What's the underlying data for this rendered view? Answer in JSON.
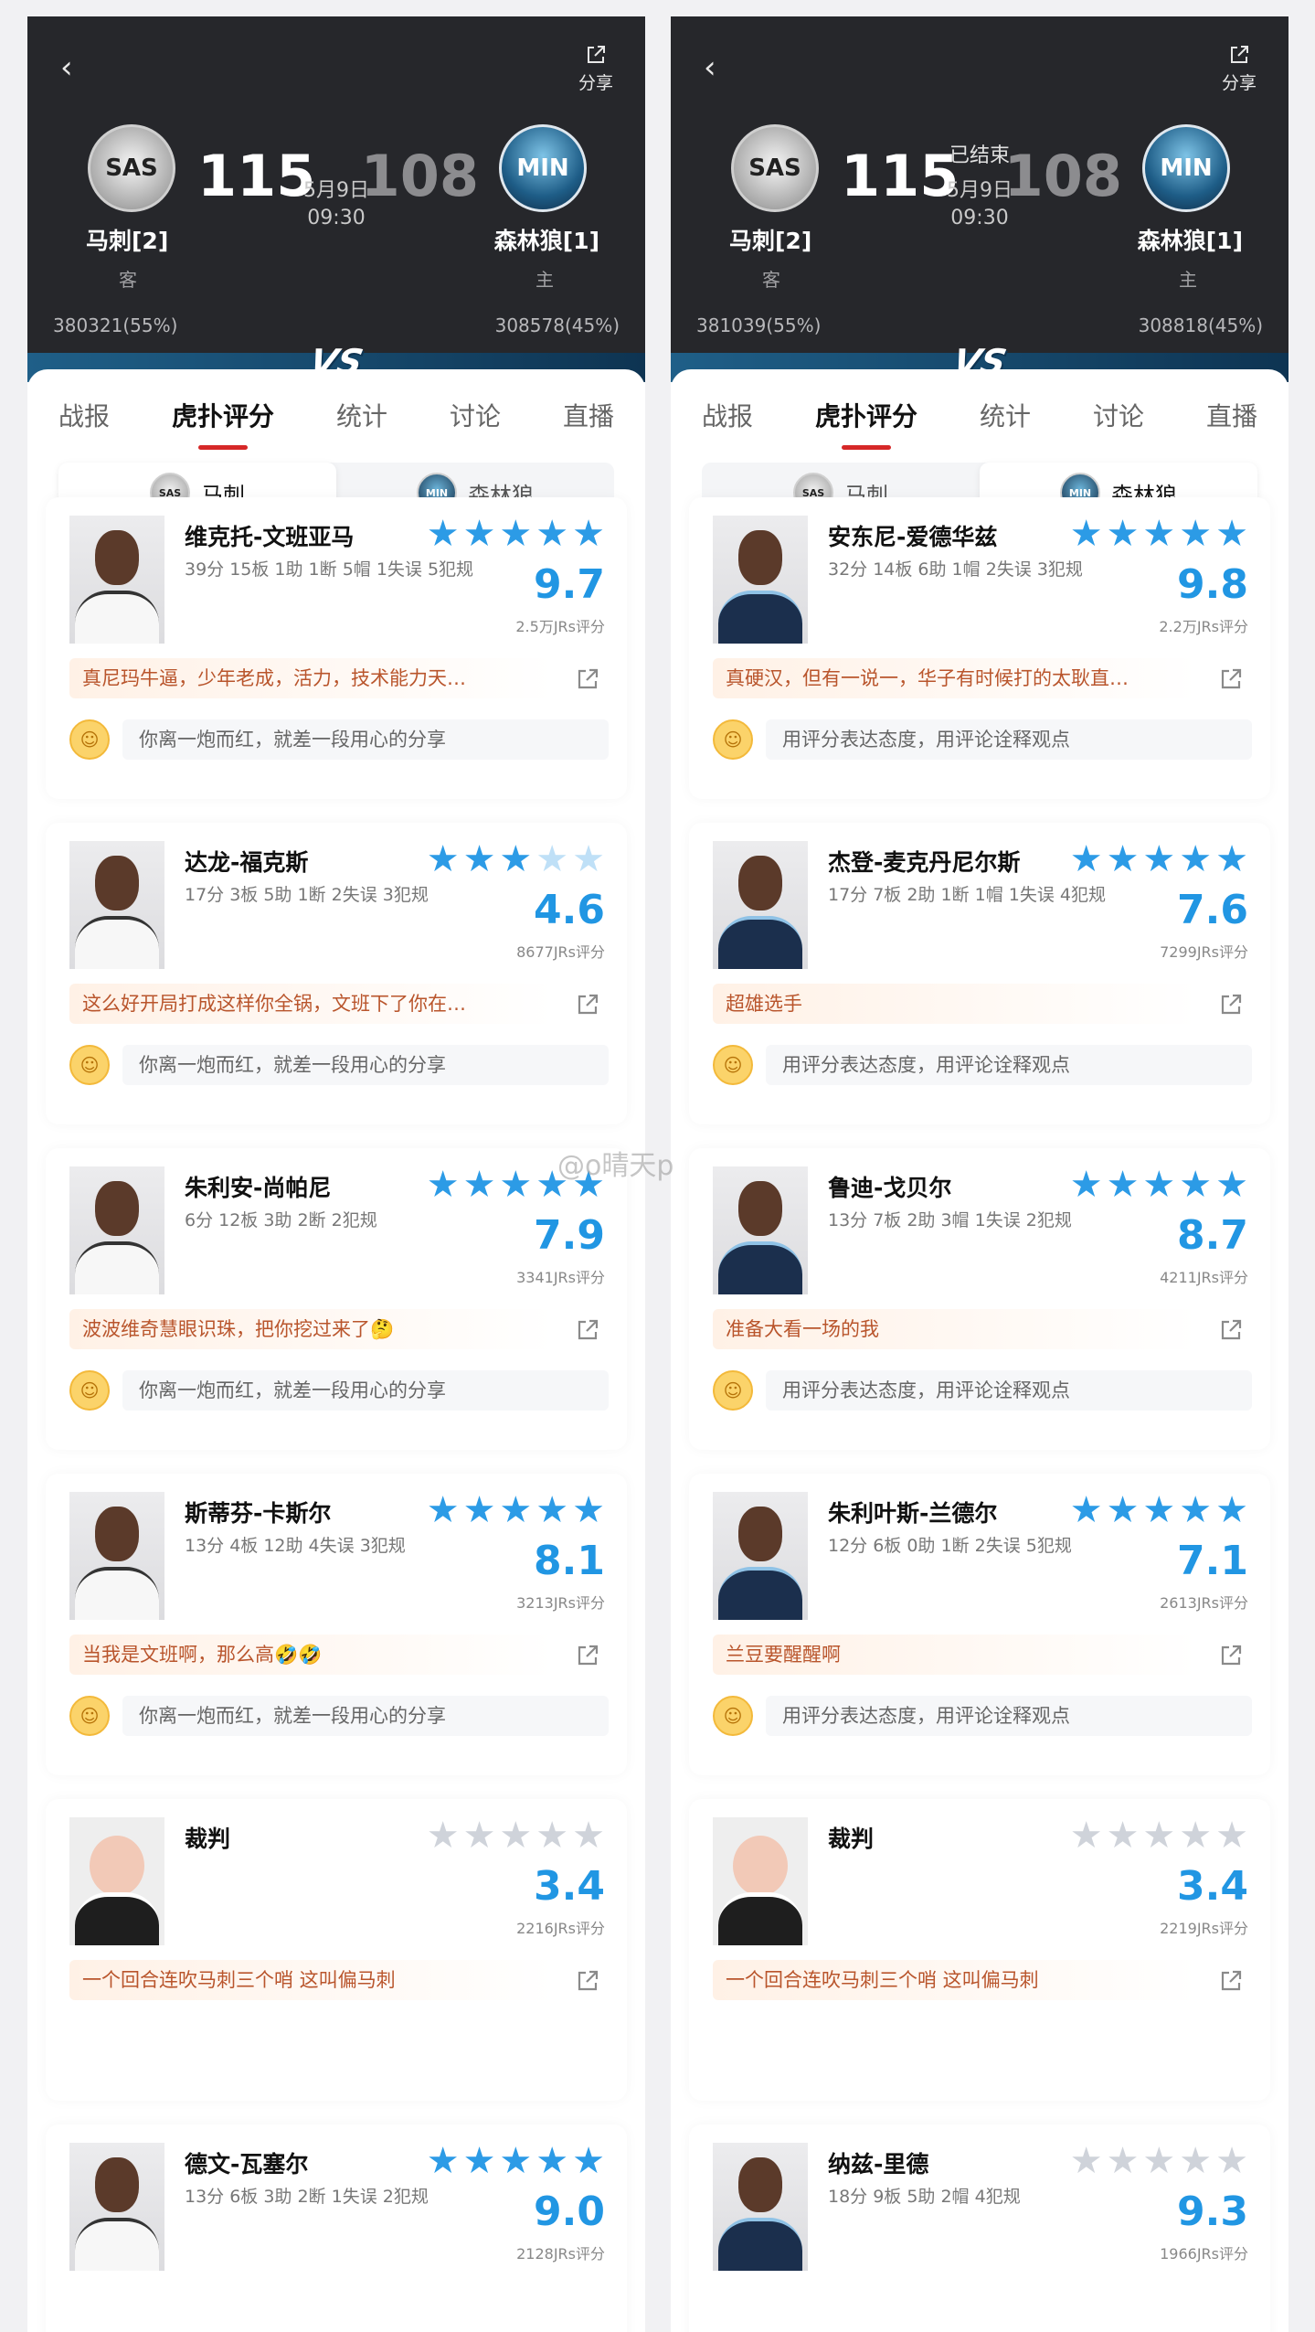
{
  "panels": [
    {
      "header": {
        "back_glyph": "‹",
        "share_label": "分享",
        "away": {
          "abbr": "SAS",
          "name": "马刺[2]",
          "role": "客",
          "score": "115",
          "votes": "380321(55%)"
        },
        "home": {
          "abbr": "MIN",
          "name": "森林狼[1]",
          "role": "主",
          "score": "108",
          "votes": "308578(45%)"
        },
        "status": "",
        "date": "5月9日",
        "time": "09:30",
        "vs": "VS"
      },
      "tabs": [
        "战报",
        "虎扑评分",
        "统计",
        "讨论",
        "直播"
      ],
      "active_tab": 1,
      "team_toggle": [
        {
          "abbr": "SAS",
          "label": "马刺",
          "selected": true
        },
        {
          "abbr": "MIN",
          "label": "森林狼",
          "selected": false
        }
      ],
      "cards": [
        {
          "name": "维克托-文班亚马",
          "stats": "39分 15板 1助 1断 5帽 1失误 5犯规",
          "rating": "9.7",
          "raters": "2.5万JRs评分",
          "stars": [
            1,
            1,
            1,
            1,
            1
          ],
          "comment": "真尼玛牛逼，少年老成，活力，技术能力天…",
          "prompt": "你离一炮而红，就差一段用心的分享",
          "kind": "spurs"
        },
        {
          "name": "达龙-福克斯",
          "stats": "17分 3板 5助 1断 2失误 3犯规",
          "rating": "4.6",
          "raters": "8677JRs评分",
          "stars": [
            1,
            1,
            1,
            0.5,
            0.5
          ],
          "comment": "这么好开局打成这样你全锅，文班下了你在…",
          "prompt": "你离一炮而红，就差一段用心的分享",
          "kind": "spurs"
        },
        {
          "name": "朱利安-尚帕尼",
          "stats": "6分 12板 3助 2断 2犯规",
          "rating": "7.9",
          "raters": "3341JRs评分",
          "stars": [
            1,
            1,
            1,
            1,
            1
          ],
          "comment": "波波维奇慧眼识珠，把你挖过来了🤔",
          "prompt": "你离一炮而红，就差一段用心的分享",
          "kind": "spurs"
        },
        {
          "name": "斯蒂芬-卡斯尔",
          "stats": "13分 4板 12助 4失误 3犯规",
          "rating": "8.1",
          "raters": "3213JRs评分",
          "stars": [
            1,
            1,
            1,
            1,
            1
          ],
          "comment": "当我是文班啊，那么高🤣🤣",
          "prompt": "你离一炮而红，就差一段用心的分享",
          "kind": "spurs"
        },
        {
          "name": "裁判",
          "stats": "",
          "rating": "3.4",
          "raters": "2216JRs评分",
          "stars": [
            0,
            0,
            0,
            0,
            0
          ],
          "comment": "一个回合连吹马刺三个哨 这叫偏马刺",
          "prompt": "",
          "kind": "referee"
        },
        {
          "name": "德文-瓦塞尔",
          "stats": "13分 6板 3助 2断 1失误 2犯规",
          "rating": "9.0",
          "raters": "2128JRs评分",
          "stars": [
            1,
            1,
            1,
            1,
            1
          ],
          "comment": "",
          "prompt": "",
          "kind": "spurs"
        }
      ]
    },
    {
      "header": {
        "back_glyph": "‹",
        "share_label": "分享",
        "away": {
          "abbr": "SAS",
          "name": "马刺[2]",
          "role": "客",
          "score": "115",
          "votes": "381039(55%)"
        },
        "home": {
          "abbr": "MIN",
          "name": "森林狼[1]",
          "role": "主",
          "score": "108",
          "votes": "308818(45%)"
        },
        "status": "已结束",
        "date": "5月9日",
        "time": "09:30",
        "vs": "VS"
      },
      "tabs": [
        "战报",
        "虎扑评分",
        "统计",
        "讨论",
        "直播"
      ],
      "active_tab": 1,
      "team_toggle": [
        {
          "abbr": "SAS",
          "label": "马刺",
          "selected": false
        },
        {
          "abbr": "MIN",
          "label": "森林狼",
          "selected": true
        }
      ],
      "cards": [
        {
          "name": "安东尼-爱德华兹",
          "stats": "32分 14板 6助 1帽 2失误 3犯规",
          "rating": "9.8",
          "raters": "2.2万JRs评分",
          "stars": [
            1,
            1,
            1,
            1,
            1
          ],
          "comment": "真硬汉，但有一说一，华子有时候打的太耿直…",
          "prompt": "用评分表达态度，用评论诠释观点",
          "kind": "wolves"
        },
        {
          "name": "杰登-麦克丹尼尔斯",
          "stats": "17分 7板 2助 1断 1帽 1失误 4犯规",
          "rating": "7.6",
          "raters": "7299JRs评分",
          "stars": [
            1,
            1,
            1,
            1,
            1
          ],
          "comment": "超雄选手",
          "prompt": "用评分表达态度，用评论诠释观点",
          "kind": "wolves"
        },
        {
          "name": "鲁迪-戈贝尔",
          "stats": "13分 7板 2助 3帽 1失误 2犯规",
          "rating": "8.7",
          "raters": "4211JRs评分",
          "stars": [
            1,
            1,
            1,
            1,
            1
          ],
          "comment": "准备大看一场的我",
          "prompt": "用评分表达态度，用评论诠释观点",
          "kind": "wolves"
        },
        {
          "name": "朱利叶斯-兰德尔",
          "stats": "12分 6板 0助 1断 2失误 5犯规",
          "rating": "7.1",
          "raters": "2613JRs评分",
          "stars": [
            1,
            1,
            1,
            1,
            1
          ],
          "comment": "兰豆要醒醒啊",
          "prompt": "用评分表达态度，用评论诠释观点",
          "kind": "wolves"
        },
        {
          "name": "裁判",
          "stats": "",
          "rating": "3.4",
          "raters": "2219JRs评分",
          "stars": [
            0,
            0,
            0,
            0,
            0
          ],
          "comment": "一个回合连吹马刺三个哨 这叫偏马刺",
          "prompt": "",
          "kind": "referee"
        },
        {
          "name": "纳兹-里德",
          "stats": "18分 9板 5助 2帽 4犯规",
          "rating": "9.3",
          "raters": "1966JRs评分",
          "stars": [
            0,
            0,
            0,
            0,
            0
          ],
          "comment": "",
          "prompt": "",
          "kind": "wolves"
        }
      ]
    }
  ],
  "watermark": "@o晴天p",
  "colors": {
    "accent_blue": "#2196e3",
    "tab_underline": "#d62828",
    "comment_text": "#b9552c",
    "header_bg": "#26272b"
  }
}
